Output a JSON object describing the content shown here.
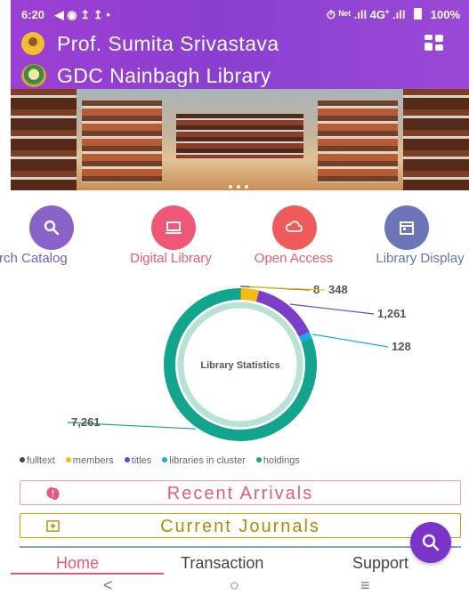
{
  "status": {
    "time": "6:20",
    "left_icons": "◀ ◉ ↥ ↥ •",
    "right_icons": "⏱ ᴺᵉᵗ .ıll 4G⁺ .ıll",
    "battery": "100%"
  },
  "header": {
    "user_name": "Prof. Sumita Srivastava",
    "library_name": "GDC Nainbagh Library",
    "grid_icon": "grid-icon"
  },
  "banner": {
    "dots": 3
  },
  "quick_links": [
    {
      "label": "Search Catalog",
      "icon": "search-icon",
      "color": "#8a63c9",
      "label_color": "#7a5fb8"
    },
    {
      "label": "Digital Library",
      "icon": "laptop-icon",
      "color": "#ef5777",
      "label_color": "#e45a79"
    },
    {
      "label": "Open Access",
      "icon": "cloud-icon",
      "color": "#ef5b5b",
      "label_color": "#f05b63"
    },
    {
      "label": "Library Display",
      "icon": "calendar-icon",
      "color": "#6b75b7",
      "label_color": "#6571bf"
    }
  ],
  "chart_data": {
    "type": "pie",
    "title": "Library Statistics",
    "categories": [
      "fulltext",
      "members",
      "titles",
      "libraries in cluster",
      "holdings"
    ],
    "values": [
      8,
      348,
      1261,
      128,
      7261
    ],
    "colors": [
      "#374957",
      "#f3bd10",
      "#7a3ec8",
      "#18a9e8",
      "#13a48e"
    ],
    "data_labels": [
      "8",
      "348",
      "1,261",
      "128",
      "7,261"
    ],
    "legend_position": "bottom"
  },
  "actions": {
    "recent_arrivals": "Recent Arrivals",
    "current_journals": "Current Journals"
  },
  "bottom_nav": {
    "home": "Home",
    "transaction": "Transaction",
    "support": "Support"
  },
  "system_nav": {
    "back": "<",
    "home": "○",
    "recents": "≡"
  }
}
